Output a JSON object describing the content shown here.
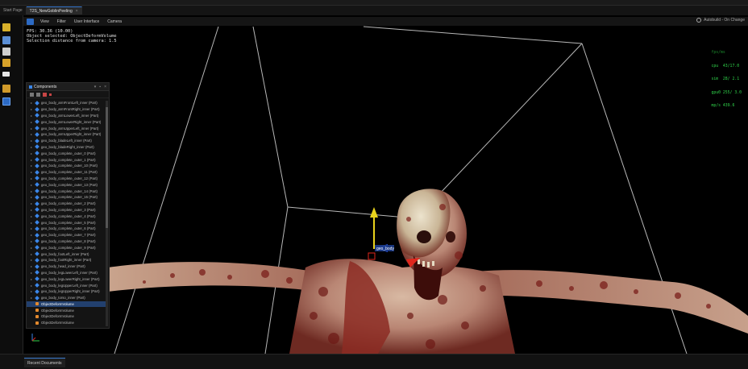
{
  "tabs": [
    {
      "label": "Start Page",
      "active": false
    },
    {
      "label": "T2S_NewGoblinPeeling",
      "active": true
    }
  ],
  "menu": {
    "items": [
      "View",
      "Filter",
      "User Interface",
      "Camera"
    ],
    "autobuild": "Autobuild - On Change"
  },
  "overlay": {
    "fps": "FPS: 30.36 (10.00)",
    "selected": "Object selected: ObjectDeformVolume",
    "distance": "Selection distance from camera: 1.5"
  },
  "stats": {
    "header": "fps/ms",
    "lines": [
      "cpu  43/17.0",
      "sim  28/ 2.1",
      "gpu0 255/ 3.0",
      "mp/s 439.6"
    ]
  },
  "components": {
    "title": "Components",
    "items": [
      {
        "label": "geo_body_armFrontLeft_inner (Part)",
        "icon": "part-icon"
      },
      {
        "label": "geo_body_armFrontRight_inner (Part)",
        "icon": "part-icon"
      },
      {
        "label": "geo_body_armLowerLeft_inner (Part)",
        "icon": "part-icon"
      },
      {
        "label": "geo_body_armLowerRight_inner (Part)",
        "icon": "part-icon"
      },
      {
        "label": "geo_body_armUpperLeft_inner (Part)",
        "icon": "part-icon"
      },
      {
        "label": "geo_body_armUpperRight_inner (Part)",
        "icon": "part-icon"
      },
      {
        "label": "geo_body_bladeLeft_inner (Part)",
        "icon": "part-icon"
      },
      {
        "label": "geo_body_bladeRight_inner (Part)",
        "icon": "part-icon"
      },
      {
        "label": "geo_body_complete_outer_0 (Part)",
        "icon": "part-icon"
      },
      {
        "label": "geo_body_complete_outer_1 (Part)",
        "icon": "part-icon"
      },
      {
        "label": "geo_body_complete_outer_10 (Part)",
        "icon": "part-icon"
      },
      {
        "label": "geo_body_complete_outer_11 (Part)",
        "icon": "part-icon"
      },
      {
        "label": "geo_body_complete_outer_12 (Part)",
        "icon": "part-icon"
      },
      {
        "label": "geo_body_complete_outer_13 (Part)",
        "icon": "part-icon"
      },
      {
        "label": "geo_body_complete_outer_14 (Part)",
        "icon": "part-icon"
      },
      {
        "label": "geo_body_complete_outer_15 (Part)",
        "icon": "part-icon"
      },
      {
        "label": "geo_body_complete_outer_2 (Part)",
        "icon": "part-icon"
      },
      {
        "label": "geo_body_complete_outer_3 (Part)",
        "icon": "part-icon"
      },
      {
        "label": "geo_body_complete_outer_4 (Part)",
        "icon": "part-icon"
      },
      {
        "label": "geo_body_complete_outer_5 (Part)",
        "icon": "part-icon"
      },
      {
        "label": "geo_body_complete_outer_6 (Part)",
        "icon": "part-icon"
      },
      {
        "label": "geo_body_complete_outer_7 (Part)",
        "icon": "part-icon"
      },
      {
        "label": "geo_body_complete_outer_8 (Part)",
        "icon": "part-icon"
      },
      {
        "label": "geo_body_complete_outer_9 (Part)",
        "icon": "part-icon"
      },
      {
        "label": "geo_body_footLeft_inner (Part)",
        "icon": "part-icon"
      },
      {
        "label": "geo_body_footRight_inner (Part)",
        "icon": "part-icon"
      },
      {
        "label": "geo_body_head_inner (Part)",
        "icon": "part-icon"
      },
      {
        "label": "geo_body_legLowerLeft_inner (Part)",
        "icon": "part-icon"
      },
      {
        "label": "geo_body_legLowerRight_inner (Part)",
        "icon": "part-icon"
      },
      {
        "label": "geo_body_legUpperLeft_inner (Part)",
        "icon": "part-icon"
      },
      {
        "label": "geo_body_legUpperRight_inner (Part)",
        "icon": "part-icon"
      },
      {
        "label": "geo_body_torso_inner (Part)",
        "icon": "part-icon"
      },
      {
        "label": "ObjectDeformVolume",
        "icon": "deform-volume-icon",
        "selected": true
      },
      {
        "label": "ObjectDeformVolume",
        "icon": "deform-volume-icon"
      },
      {
        "label": "ObjectDeformVolume",
        "icon": "deform-volume-icon"
      },
      {
        "label": "ObjectDeformVolume",
        "icon": "deform-volume-icon"
      }
    ]
  },
  "gizmo": {
    "label": "geo_body"
  },
  "bottom": {
    "tab": "Recent Documents"
  },
  "colors": {
    "accent": "#3b7bd0",
    "stats_green": "#2fd34a",
    "selection": "#22406e"
  }
}
